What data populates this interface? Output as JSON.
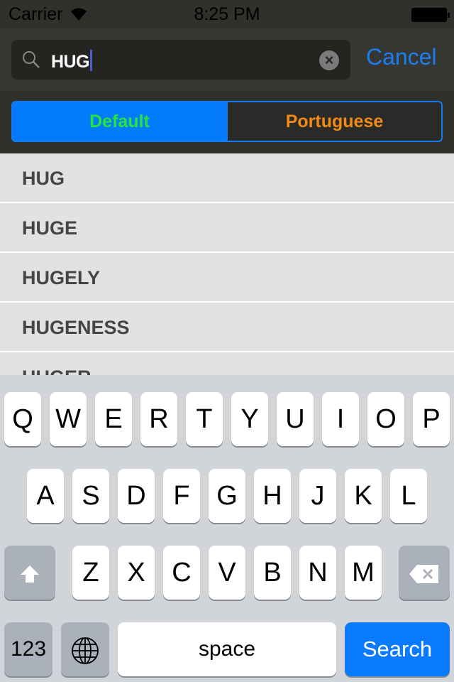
{
  "status": {
    "carrier": "Carrier",
    "time": "8:25 PM",
    "wifi_icon": "wifi-icon",
    "battery_icon": "battery-icon"
  },
  "search": {
    "query": "HUG",
    "cancel_label": "Cancel"
  },
  "scope": {
    "options": [
      "Default",
      "Portuguese"
    ],
    "selected": "Default",
    "selected_color": "#25e63a",
    "other_color": "#f28a16"
  },
  "results": [
    "HUG",
    "HUGE",
    "HUGELY",
    "HUGENESS",
    "HUGER"
  ],
  "keyboard": {
    "row1": [
      "Q",
      "W",
      "E",
      "R",
      "T",
      "Y",
      "U",
      "I",
      "O",
      "P"
    ],
    "row2": [
      "A",
      "S",
      "D",
      "F",
      "G",
      "H",
      "J",
      "K",
      "L"
    ],
    "row3": [
      "Z",
      "X",
      "C",
      "V",
      "B",
      "N",
      "M"
    ],
    "numbers_label": "123",
    "space_label": "space",
    "search_label": "Search"
  },
  "colors": {
    "accent": "#0a7afe"
  }
}
